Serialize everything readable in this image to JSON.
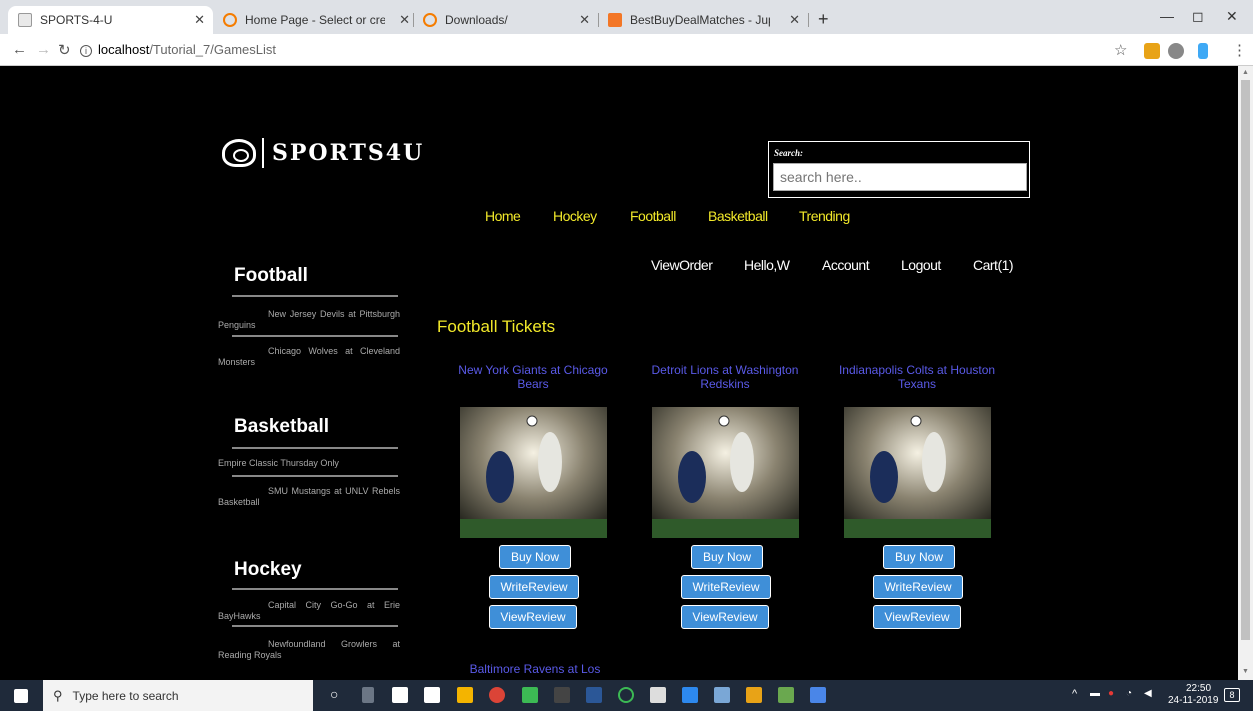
{
  "browser": {
    "tabs": [
      {
        "label": "SPORTS-4-U"
      },
      {
        "label": "Home Page - Select or create a n"
      },
      {
        "label": "Downloads/"
      },
      {
        "label": "BestBuyDealMatches - Jupyter N"
      }
    ],
    "url_host": "localhost",
    "url_path": "/Tutorial_7/GamesList"
  },
  "site": {
    "logo_text": "SPORTS4U",
    "search_label": "Search:",
    "search_placeholder": "search here..",
    "main_nav": [
      "Home",
      "Hockey",
      "Football",
      "Basketball",
      "Trending"
    ],
    "user_nav": [
      "ViewOrder",
      "Hello,W",
      "Account",
      "Logout",
      "Cart(1)"
    ]
  },
  "sidebar": [
    {
      "heading": "Football",
      "links": [
        "New Jersey Devils at Pittsburgh Penguins",
        "Chicago Wolves at Cleveland Monsters"
      ]
    },
    {
      "heading": "Basketball",
      "links": [
        "Empire Classic Thursday Only",
        "SMU Mustangs at UNLV Rebels Basketball"
      ]
    },
    {
      "heading": "Hockey",
      "links": [
        "Capital City Go-Go at Erie BayHawks",
        "Newfoundland Growlers at Reading Royals"
      ]
    }
  ],
  "content": {
    "section_title": "Football Tickets",
    "products": [
      {
        "title": "New York Giants at Chicago Bears"
      },
      {
        "title": "Detroit Lions at Washington Redskins"
      },
      {
        "title": "Indianapolis Colts at Houston Texans"
      },
      {
        "title": "Baltimore Ravens at Los"
      }
    ],
    "buttons": {
      "buy": "Buy Now",
      "write": "WriteReview",
      "view": "ViewReview"
    }
  },
  "taskbar": {
    "search_placeholder": "Type here to search",
    "time": "22:50",
    "date": "24-11-2019",
    "notifications": "8"
  }
}
